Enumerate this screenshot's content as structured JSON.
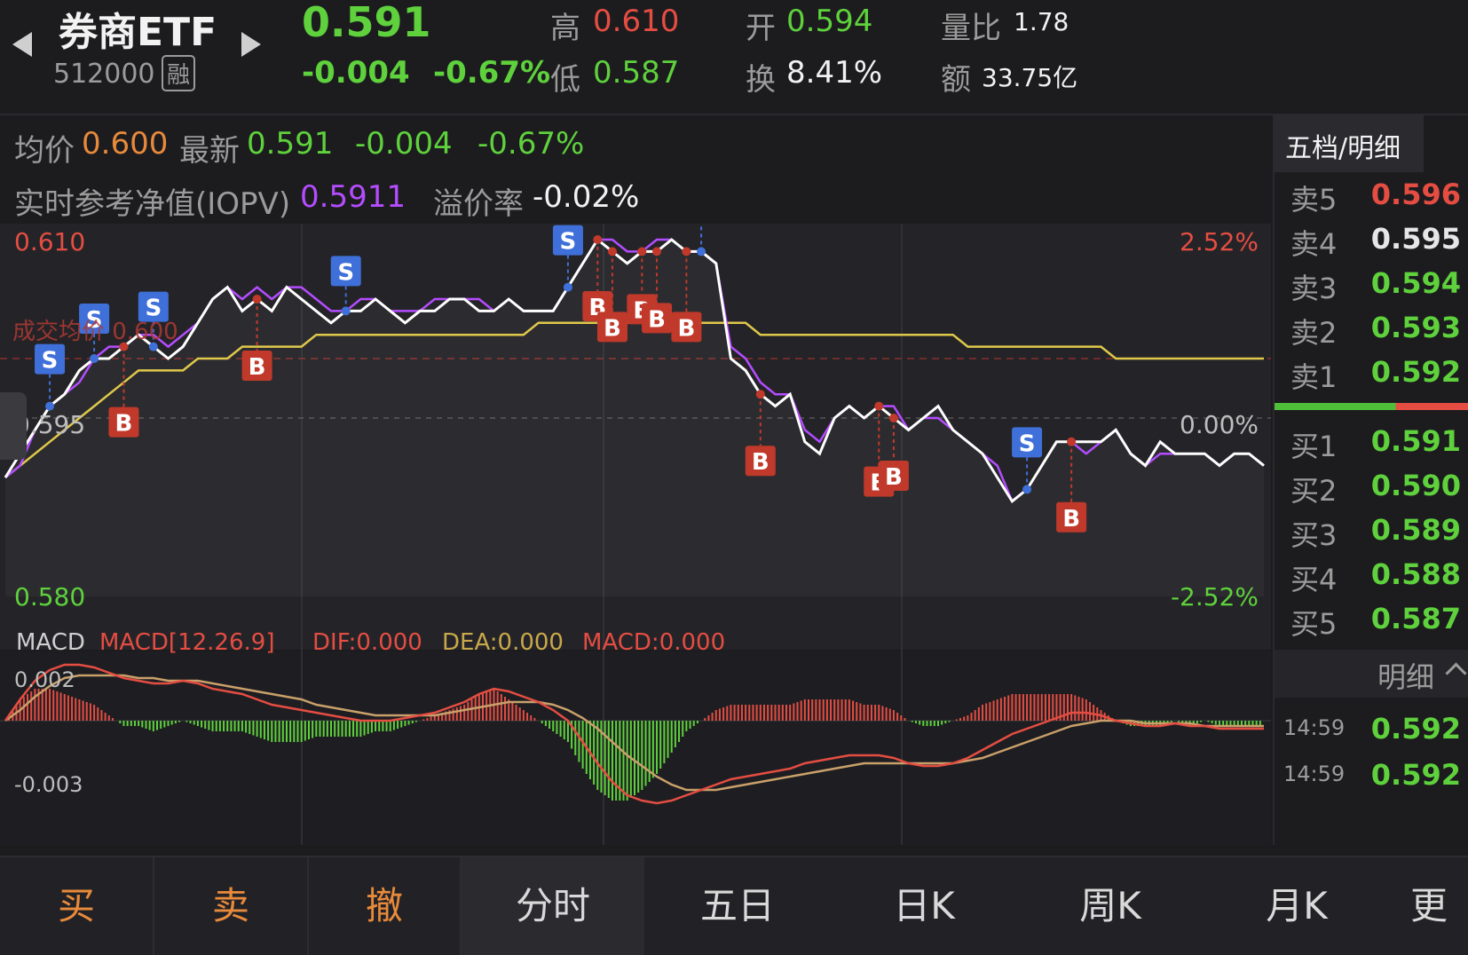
{
  "header": {
    "name": "券商ETF",
    "code": "512000",
    "margin_tag": "融",
    "price": "0.591",
    "change": "-0.004",
    "change_pct": "-0.67%",
    "high_label": "高",
    "high": "0.610",
    "low_label": "低",
    "low": "0.587",
    "open_label": "开",
    "open": "0.594",
    "turnover_label": "换",
    "turnover": "8.41%",
    "volratio_label": "量比",
    "volratio": "1.78",
    "amount_label": "额",
    "amount": "33.75亿"
  },
  "info": {
    "avg_label": "均价",
    "avg": "0.600",
    "last_label": "最新",
    "last": "0.591",
    "chg": "-0.004",
    "chg_pct": "-0.67%",
    "iopv_label": "实时参考净值(IOPV)",
    "iopv": "0.5911",
    "premium_label": "溢价率",
    "premium": "-0.02%"
  },
  "chart_data": {
    "type": "line",
    "y_left_labels": [
      "0.610",
      "0.595",
      "0.580"
    ],
    "y_right_labels": [
      "2.52%",
      "0.00%",
      "-2.52%"
    ],
    "ylim": [
      0.58,
      0.61
    ],
    "prev_close": 0.595,
    "avg_price_line_label": "成交均价 0.600",
    "series": [
      {
        "role": "price",
        "color": "#ffffff",
        "values": [
          0.59,
          0.592,
          0.594,
          0.596,
          0.597,
          0.599,
          0.6,
          0.6,
          0.601,
          0.602,
          0.601,
          0.6,
          0.601,
          0.603,
          0.605,
          0.606,
          0.604,
          0.605,
          0.604,
          0.606,
          0.605,
          0.604,
          0.603,
          0.604,
          0.604,
          0.605,
          0.604,
          0.603,
          0.604,
          0.604,
          0.605,
          0.605,
          0.604,
          0.604,
          0.605,
          0.604,
          0.604,
          0.604,
          0.606,
          0.608,
          0.61,
          0.609,
          0.608,
          0.609,
          0.609,
          0.61,
          0.609,
          0.609,
          0.608,
          0.6,
          0.599,
          0.597,
          0.596,
          0.597,
          0.593,
          0.592,
          0.595,
          0.596,
          0.595,
          0.596,
          0.595,
          0.594,
          0.595,
          0.596,
          0.594,
          0.593,
          0.592,
          0.59,
          0.588,
          0.589,
          0.591,
          0.593,
          0.593,
          0.593,
          0.593,
          0.594,
          0.592,
          0.591,
          0.593,
          0.592,
          0.592,
          0.592,
          0.591,
          0.592,
          0.592,
          0.591
        ]
      },
      {
        "role": "iopv",
        "color": "#b44cff",
        "values": [
          0.59,
          0.591,
          0.594,
          0.596,
          0.597,
          0.598,
          0.6,
          0.601,
          0.601,
          0.602,
          0.602,
          0.601,
          0.602,
          0.603,
          0.605,
          0.606,
          0.605,
          0.606,
          0.605,
          0.606,
          0.606,
          0.605,
          0.604,
          0.604,
          0.605,
          0.605,
          0.604,
          0.604,
          0.604,
          0.605,
          0.605,
          0.605,
          0.605,
          0.604,
          0.605,
          0.604,
          0.604,
          0.604,
          0.606,
          0.608,
          0.61,
          0.61,
          0.609,
          0.609,
          0.61,
          0.61,
          0.609,
          0.609,
          0.608,
          0.601,
          0.6,
          0.598,
          0.597,
          0.597,
          0.594,
          0.593,
          0.595,
          0.596,
          0.595,
          0.596,
          0.596,
          0.594,
          0.595,
          0.595,
          0.594,
          0.593,
          0.592,
          0.591,
          0.588,
          0.589,
          0.591,
          0.593,
          0.593,
          0.592,
          0.593,
          0.594,
          0.592,
          0.591,
          0.592,
          0.592,
          0.592,
          0.592,
          0.591,
          0.592,
          0.592,
          0.591
        ]
      },
      {
        "role": "avg",
        "color": "#e0c84a",
        "values": [
          0.59,
          0.591,
          0.592,
          0.593,
          0.594,
          0.595,
          0.596,
          0.597,
          0.598,
          0.599,
          0.599,
          0.599,
          0.599,
          0.6,
          0.6,
          0.6,
          0.601,
          0.601,
          0.601,
          0.601,
          0.601,
          0.602,
          0.602,
          0.602,
          0.602,
          0.602,
          0.602,
          0.602,
          0.602,
          0.602,
          0.602,
          0.602,
          0.602,
          0.602,
          0.602,
          0.602,
          0.603,
          0.603,
          0.603,
          0.603,
          0.603,
          0.603,
          0.603,
          0.603,
          0.603,
          0.603,
          0.603,
          0.603,
          0.603,
          0.603,
          0.603,
          0.602,
          0.602,
          0.602,
          0.602,
          0.602,
          0.602,
          0.602,
          0.602,
          0.602,
          0.602,
          0.602,
          0.602,
          0.602,
          0.602,
          0.601,
          0.601,
          0.601,
          0.601,
          0.601,
          0.601,
          0.601,
          0.601,
          0.601,
          0.601,
          0.6,
          0.6,
          0.6,
          0.6,
          0.6,
          0.6,
          0.6,
          0.6,
          0.6,
          0.6,
          0.6
        ]
      }
    ],
    "signals": [
      {
        "type": "S",
        "i": 3
      },
      {
        "type": "S",
        "i": 6
      },
      {
        "type": "B",
        "i": 8
      },
      {
        "type": "S",
        "i": 10
      },
      {
        "type": "B",
        "i": 17
      },
      {
        "type": "S",
        "i": 23
      },
      {
        "type": "S",
        "i": 38
      },
      {
        "type": "B",
        "i": 40
      },
      {
        "type": "B",
        "i": 41
      },
      {
        "type": "B",
        "i": 43
      },
      {
        "type": "B",
        "i": 44
      },
      {
        "type": "B",
        "i": 46
      },
      {
        "type": "S",
        "i": 47
      },
      {
        "type": "B",
        "i": 51
      },
      {
        "type": "B",
        "i": 59
      },
      {
        "type": "B",
        "i": 60
      },
      {
        "type": "S",
        "i": 69
      },
      {
        "type": "B",
        "i": 72
      }
    ],
    "macd": {
      "title": "MACD",
      "params": "MACD[12.26.9]",
      "dif_label": "DIF:0.000",
      "dea_label": "DEA:0.000",
      "macd_label": "MACD:0.000",
      "y_top_label": "0.002",
      "y_bottom_label": "-0.003",
      "ylim": [
        -0.003,
        0.002
      ],
      "dif": [
        0.0,
        0.0008,
        0.0015,
        0.0019,
        0.0021,
        0.0021,
        0.002,
        0.0018,
        0.0016,
        0.0015,
        0.0014,
        0.0014,
        0.0015,
        0.0014,
        0.0012,
        0.0011,
        0.001,
        0.0008,
        0.0006,
        0.0005,
        0.0004,
        0.0003,
        0.0002,
        0.0001,
        0.0,
        0.0,
        0.0,
        0.0001,
        0.0002,
        0.0003,
        0.0005,
        0.0007,
        0.001,
        0.0012,
        0.0011,
        0.0009,
        0.0007,
        0.0004,
        0.0,
        -0.0008,
        -0.0016,
        -0.0023,
        -0.0028,
        -0.003,
        -0.0031,
        -0.003,
        -0.0028,
        -0.0026,
        -0.0024,
        -0.0022,
        -0.0021,
        -0.002,
        -0.0019,
        -0.0018,
        -0.0016,
        -0.0015,
        -0.0014,
        -0.0013,
        -0.0013,
        -0.0013,
        -0.0014,
        -0.0016,
        -0.0017,
        -0.0017,
        -0.0016,
        -0.0014,
        -0.0011,
        -0.0008,
        -0.0005,
        -0.0003,
        -0.0001,
        0.0001,
        0.0003,
        0.0003,
        0.0002,
        0.0,
        -0.0001,
        -0.0002,
        -0.0002,
        -0.0001,
        -0.0002,
        -0.0002,
        -0.0003,
        -0.0003,
        -0.0003,
        -0.0003
      ],
      "dea": [
        0.0,
        0.0004,
        0.0009,
        0.0013,
        0.0016,
        0.0017,
        0.0017,
        0.0017,
        0.0017,
        0.0016,
        0.0016,
        0.0015,
        0.0015,
        0.0015,
        0.0014,
        0.0013,
        0.0012,
        0.0011,
        0.001,
        0.0009,
        0.0008,
        0.0006,
        0.0005,
        0.0004,
        0.0003,
        0.0002,
        0.0002,
        0.0002,
        0.0002,
        0.0002,
        0.0003,
        0.0004,
        0.0005,
        0.0006,
        0.0007,
        0.0007,
        0.0007,
        0.0006,
        0.0004,
        0.0001,
        -0.0003,
        -0.0008,
        -0.0013,
        -0.0017,
        -0.0021,
        -0.0024,
        -0.0026,
        -0.0026,
        -0.0026,
        -0.0025,
        -0.0024,
        -0.0023,
        -0.0022,
        -0.0021,
        -0.002,
        -0.0019,
        -0.0018,
        -0.0017,
        -0.0016,
        -0.0016,
        -0.0016,
        -0.0016,
        -0.0016,
        -0.0016,
        -0.0016,
        -0.0015,
        -0.0014,
        -0.0012,
        -0.001,
        -0.0008,
        -0.0006,
        -0.0004,
        -0.0002,
        -0.0001,
        0.0,
        0.0,
        0.0,
        -0.0001,
        -0.0001,
        -0.0001,
        -0.0001,
        -0.0002,
        -0.0002,
        -0.0002,
        -0.0002,
        -0.0002
      ]
    }
  },
  "panel": {
    "tab_title": "五档/明细",
    "asks": [
      {
        "label": "卖5",
        "price": "0.596",
        "color": "#e54d42"
      },
      {
        "label": "卖4",
        "price": "0.595",
        "color": "#e6e6e6"
      },
      {
        "label": "卖3",
        "price": "0.594",
        "color": "#5ed13c"
      },
      {
        "label": "卖2",
        "price": "0.593",
        "color": "#5ed13c"
      },
      {
        "label": "卖1",
        "price": "0.592",
        "color": "#5ed13c"
      }
    ],
    "bids": [
      {
        "label": "买1",
        "price": "0.591",
        "color": "#5ed13c"
      },
      {
        "label": "买2",
        "price": "0.590",
        "color": "#5ed13c"
      },
      {
        "label": "买3",
        "price": "0.589",
        "color": "#5ed13c"
      },
      {
        "label": "买4",
        "price": "0.588",
        "color": "#5ed13c"
      },
      {
        "label": "买5",
        "price": "0.587",
        "color": "#5ed13c"
      }
    ],
    "detail_label": "明细",
    "ticks": [
      {
        "time": "14:59",
        "price": "0.592"
      },
      {
        "time": "14:59",
        "price": "0.592"
      }
    ]
  },
  "bottom": {
    "buy": "买",
    "sell": "卖",
    "cancel": "撤",
    "tabs": [
      "分时",
      "五日",
      "日K",
      "周K",
      "月K",
      "更"
    ]
  },
  "colors": {
    "up": "#e54d42",
    "down": "#5ed13c",
    "accent": "#e88a3b",
    "iopv": "#b44cff",
    "avg": "#e0c84a",
    "sell_marker": "#3f6fd8",
    "buy_marker": "#c0392b"
  }
}
